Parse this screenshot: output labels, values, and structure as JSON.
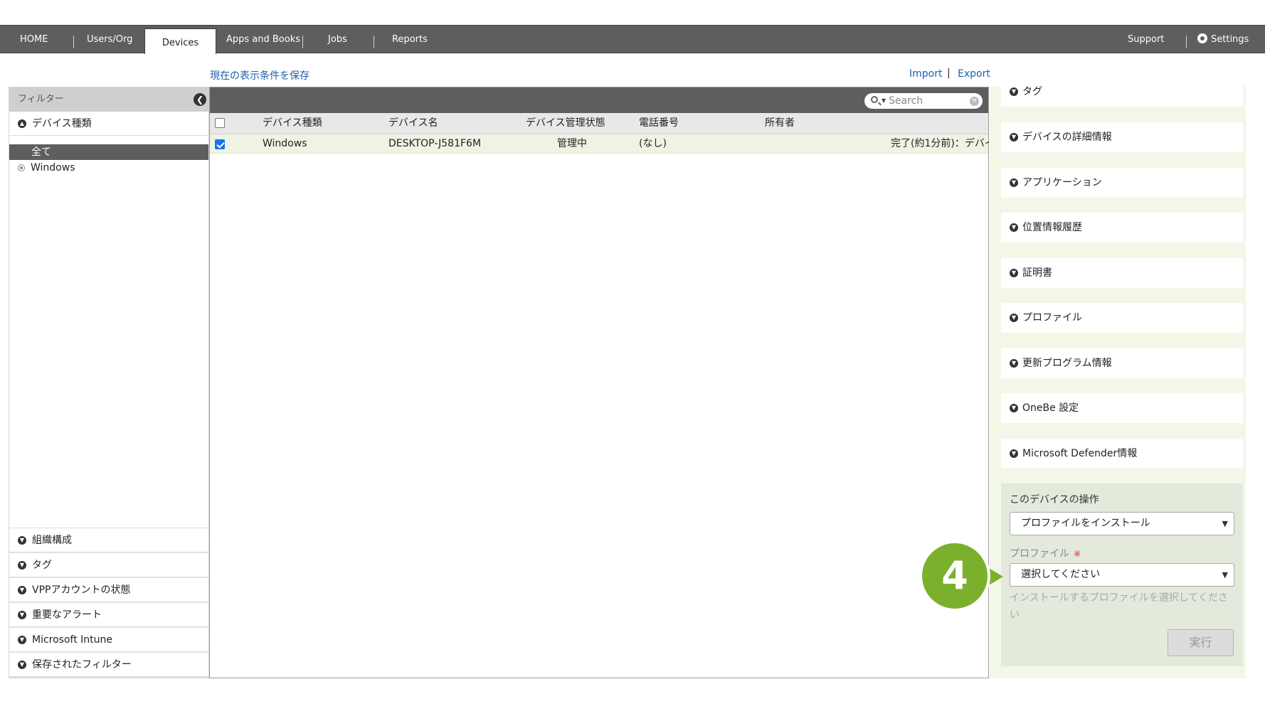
{
  "nav": {
    "home": "HOME",
    "users_org": "Users/Org",
    "devices": "Devices",
    "apps_books": "Apps and Books",
    "jobs": "Jobs",
    "reports": "Reports",
    "support": "Support",
    "settings": "Settings"
  },
  "links": {
    "save_filter": "現在の表示条件を保存",
    "import": "Import",
    "separator": "|",
    "export": "Export"
  },
  "filter": {
    "header": "フィルター",
    "device_type_section": "デバイス種類",
    "options": [
      "全て",
      "Windows"
    ],
    "bottom_sections": [
      "組織構成",
      "タグ",
      "VPPアカウントの状態",
      "重要なアラート",
      "Microsoft Intune",
      "保存されたフィルター"
    ]
  },
  "search": {
    "placeholder": "Search"
  },
  "table": {
    "columns": [
      "デバイス種類",
      "デバイス名",
      "デバイス管理状態",
      "電話番号",
      "所有者"
    ],
    "rows": [
      {
        "device_type": "Windows",
        "device_name": "DESKTOP-J581F6M",
        "status": "管理中",
        "phone": "(なし)",
        "owner": "",
        "last_job": "完了(約1分前)：デバイ"
      }
    ]
  },
  "details": {
    "sections": [
      "タグ",
      "デバイスの詳細情報",
      "アプリケーション",
      "位置情報履歴",
      "証明書",
      "プロファイル",
      "更新プログラム情報",
      "OneBe 設定",
      "Microsoft Defender情報"
    ]
  },
  "operations": {
    "title": "このデバイスの操作",
    "action_selected": "プロファイルをインストール",
    "profile_label": "プロファイル",
    "required_mark": "※",
    "profile_selected": "選択してください",
    "hint": "インストールするプロファイルを選択してください",
    "run_button": "実行"
  },
  "callout": {
    "step_number": "4"
  },
  "colors": {
    "nav_bg": "#5e5e5e",
    "link": "#1e5fa8",
    "accent_green": "#7bb02c",
    "panel_green": "#f2f7e8"
  }
}
